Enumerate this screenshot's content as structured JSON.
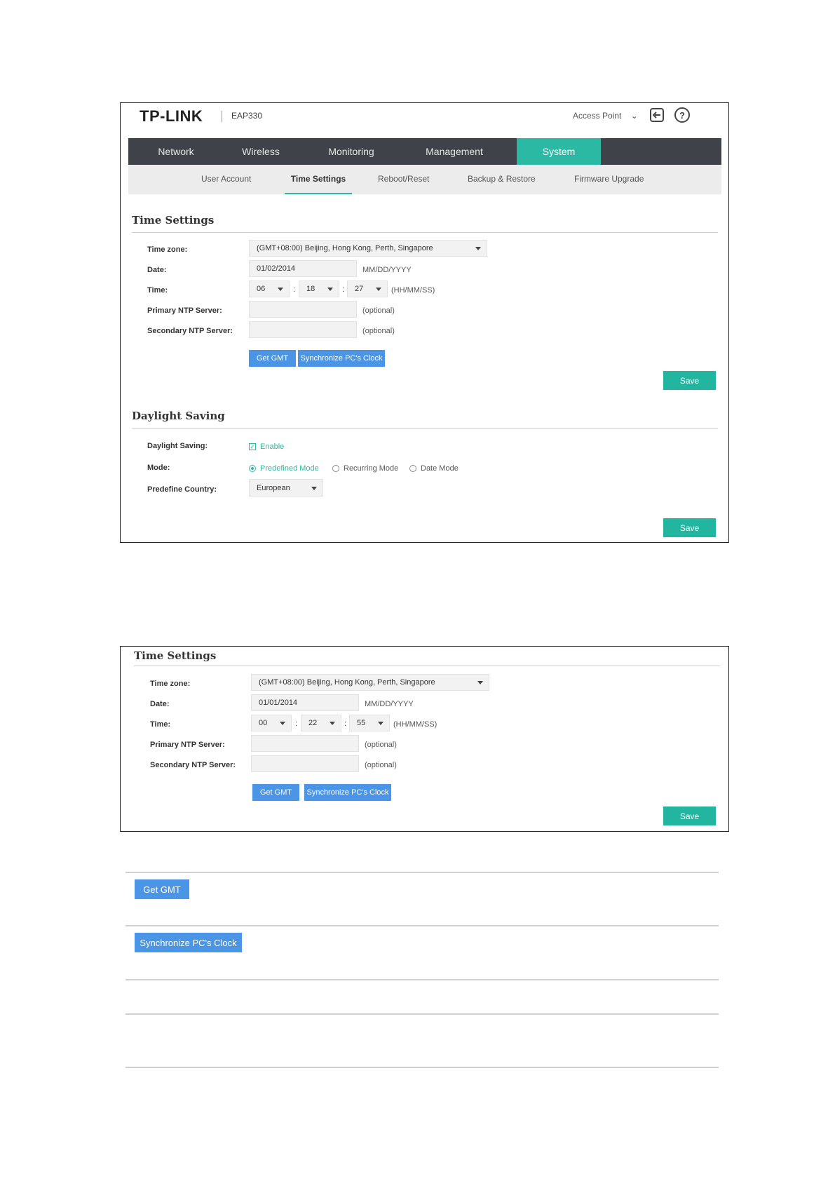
{
  "screen1": {
    "header": {
      "logo": "TP-LINK",
      "model": "EAP330",
      "mode_label": "Access Point",
      "mode_chevron": "⌄",
      "logout_icon": "logout-icon",
      "help_icon": "?"
    },
    "nav": {
      "items": [
        "Network",
        "Wireless",
        "Monitoring",
        "Management",
        "System"
      ],
      "active": "System"
    },
    "subnav": {
      "items": [
        "User Account",
        "Time Settings",
        "Reboot/Reset",
        "Backup & Restore",
        "Firmware Upgrade"
      ],
      "active": "Time Settings"
    },
    "time_settings": {
      "title": "Time Settings",
      "timezone_label": "Time zone:",
      "timezone_value": "(GMT+08:00) Beijing, Hong Kong, Perth, Singapore",
      "date_label": "Date:",
      "date_value": "01/02/2014",
      "date_format": "MM/DD/YYYY",
      "time_label": "Time:",
      "hour": "06",
      "minute": "18",
      "second": "27",
      "colon": ":",
      "time_format": "(HH/MM/SS)",
      "primary_ntp_label": "Primary NTP Server:",
      "primary_ntp_value": "",
      "secondary_ntp_label": "Secondary NTP Server:",
      "secondary_ntp_value": "",
      "optional": "(optional)",
      "get_gmt": "Get GMT",
      "sync_clock": "Synchronize PC's Clock",
      "save": "Save"
    },
    "daylight": {
      "title": "Daylight Saving",
      "ds_label": "Daylight Saving:",
      "enable": "Enable",
      "enable_checked": true,
      "mode_label": "Mode:",
      "modes": [
        "Predefined Mode",
        "Recurring Mode",
        "Date Mode"
      ],
      "selected_mode": "Predefined Mode",
      "country_label": "Predefine Country:",
      "country_value": "European",
      "save": "Save"
    }
  },
  "screen2": {
    "title": "Time Settings",
    "timezone_label": "Time zone:",
    "timezone_value": "(GMT+08:00) Beijing, Hong Kong, Perth, Singapore",
    "date_label": "Date:",
    "date_value": "01/01/2014",
    "date_format": "MM/DD/YYYY",
    "time_label": "Time:",
    "hour": "00",
    "minute": "22",
    "second": "55",
    "colon": ":",
    "time_format": "(HH/MM/SS)",
    "primary_ntp_label": "Primary NTP Server:",
    "secondary_ntp_label": "Secondary NTP Server:",
    "optional": "(optional)",
    "get_gmt": "Get GMT",
    "sync_clock": "Synchronize PC's Clock",
    "save": "Save"
  },
  "table": {
    "get_gmt": "Get GMT",
    "sync_clock": "Synchronize PC's Clock"
  },
  "colors": {
    "accent": "#2bb9a3",
    "nav_bg": "#3f4349",
    "button_blue": "#4a95e6"
  }
}
